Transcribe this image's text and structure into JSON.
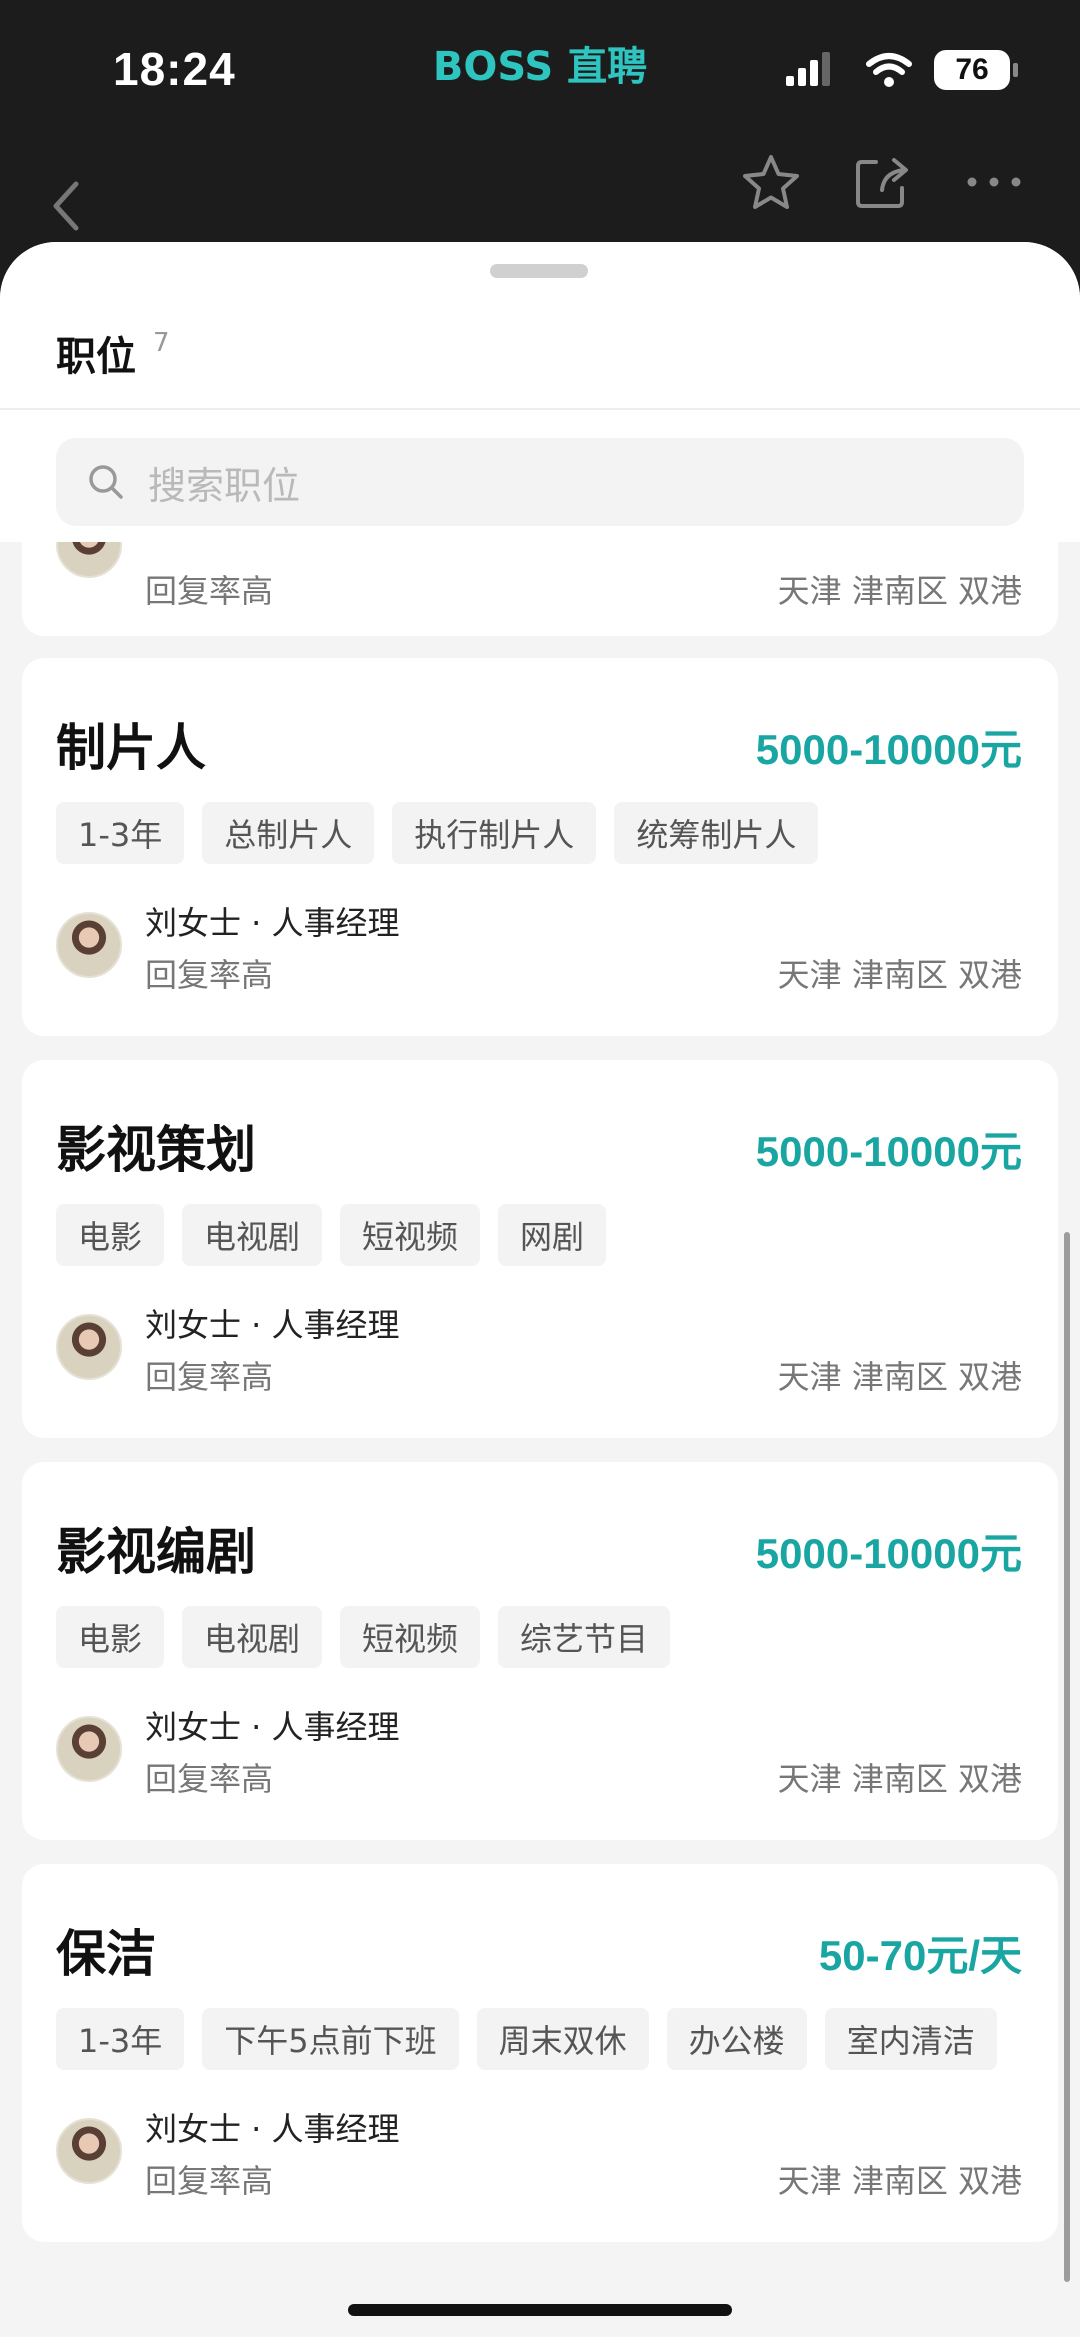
{
  "status": {
    "time": "18:24",
    "brand": "BOSS 直聘",
    "battery": "76"
  },
  "sheet": {
    "title": "职位",
    "count": "7",
    "search_placeholder": "搜索职位"
  },
  "partial_card": {
    "reply": "回复率高",
    "location": "天津 津南区 双港"
  },
  "jobs": [
    {
      "title": "制片人",
      "salary": "5000-10000元",
      "tags": [
        "1-3年",
        "总制片人",
        "执行制片人",
        "统筹制片人"
      ],
      "recruiter": "刘女士 · 人事经理",
      "reply": "回复率高",
      "location": "天津 津南区 双港"
    },
    {
      "title": "影视策划",
      "salary": "5000-10000元",
      "tags": [
        "电影",
        "电视剧",
        "短视频",
        "网剧"
      ],
      "recruiter": "刘女士 · 人事经理",
      "reply": "回复率高",
      "location": "天津 津南区 双港"
    },
    {
      "title": "影视编剧",
      "salary": "5000-10000元",
      "tags": [
        "电影",
        "电视剧",
        "短视频",
        "综艺节目"
      ],
      "recruiter": "刘女士 · 人事经理",
      "reply": "回复率高",
      "location": "天津 津南区 双港"
    },
    {
      "title": "保洁",
      "salary": "50-70元/天",
      "tags": [
        "1-3年",
        "下午5点前下班",
        "周末双休",
        "办公楼",
        "室内清洁"
      ],
      "recruiter": "刘女士 · 人事经理",
      "reply": "回复率高",
      "location": "天津 津南区 双港"
    }
  ],
  "icons": {
    "back": "chevron-left-icon",
    "favorite": "star-icon",
    "share": "share-icon",
    "more": "more-icon",
    "search": "search-icon"
  },
  "colors": {
    "accent": "#19a6a3",
    "brand": "#2ec4c0"
  }
}
